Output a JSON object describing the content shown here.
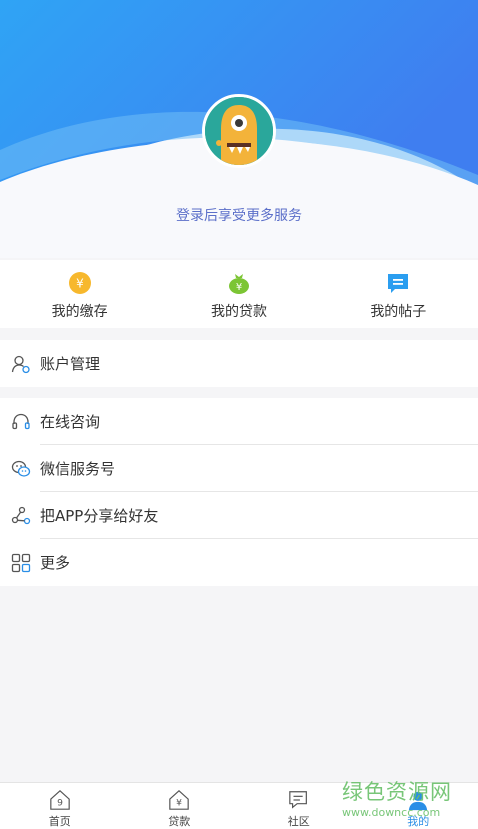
{
  "header": {
    "login_prompt": "登录后享受更多服务"
  },
  "quick_actions": [
    {
      "label": "我的缴存",
      "icon": "deposit-coin-icon",
      "color": "#f7b82d"
    },
    {
      "label": "我的贷款",
      "icon": "loan-bag-icon",
      "color": "#7cc534"
    },
    {
      "label": "我的帖子",
      "icon": "post-bubble-icon",
      "color": "#2b9ef0"
    }
  ],
  "menu_group1": [
    {
      "label": "账户管理",
      "icon": "account-user-icon"
    }
  ],
  "menu_group2": [
    {
      "label": "在线咨询",
      "icon": "headset-icon"
    },
    {
      "label": "微信服务号",
      "icon": "wechat-icon"
    },
    {
      "label": "把APP分享给好友",
      "icon": "share-icon"
    },
    {
      "label": "更多",
      "icon": "grid-more-icon"
    }
  ],
  "tabbar": [
    {
      "label": "首页",
      "icon": "home-icon"
    },
    {
      "label": "贷款",
      "icon": "loan-house-icon"
    },
    {
      "label": "社区",
      "icon": "community-chat-icon"
    },
    {
      "label": "我的",
      "icon": "profile-icon",
      "active": true
    }
  ],
  "watermark": {
    "brand": "绿色资源网",
    "site": "www.downcc.com"
  },
  "colors": {
    "header_blue": "#3a8ff0",
    "accent_text": "#5b6fc9",
    "active_tab": "#2a8ee6"
  }
}
